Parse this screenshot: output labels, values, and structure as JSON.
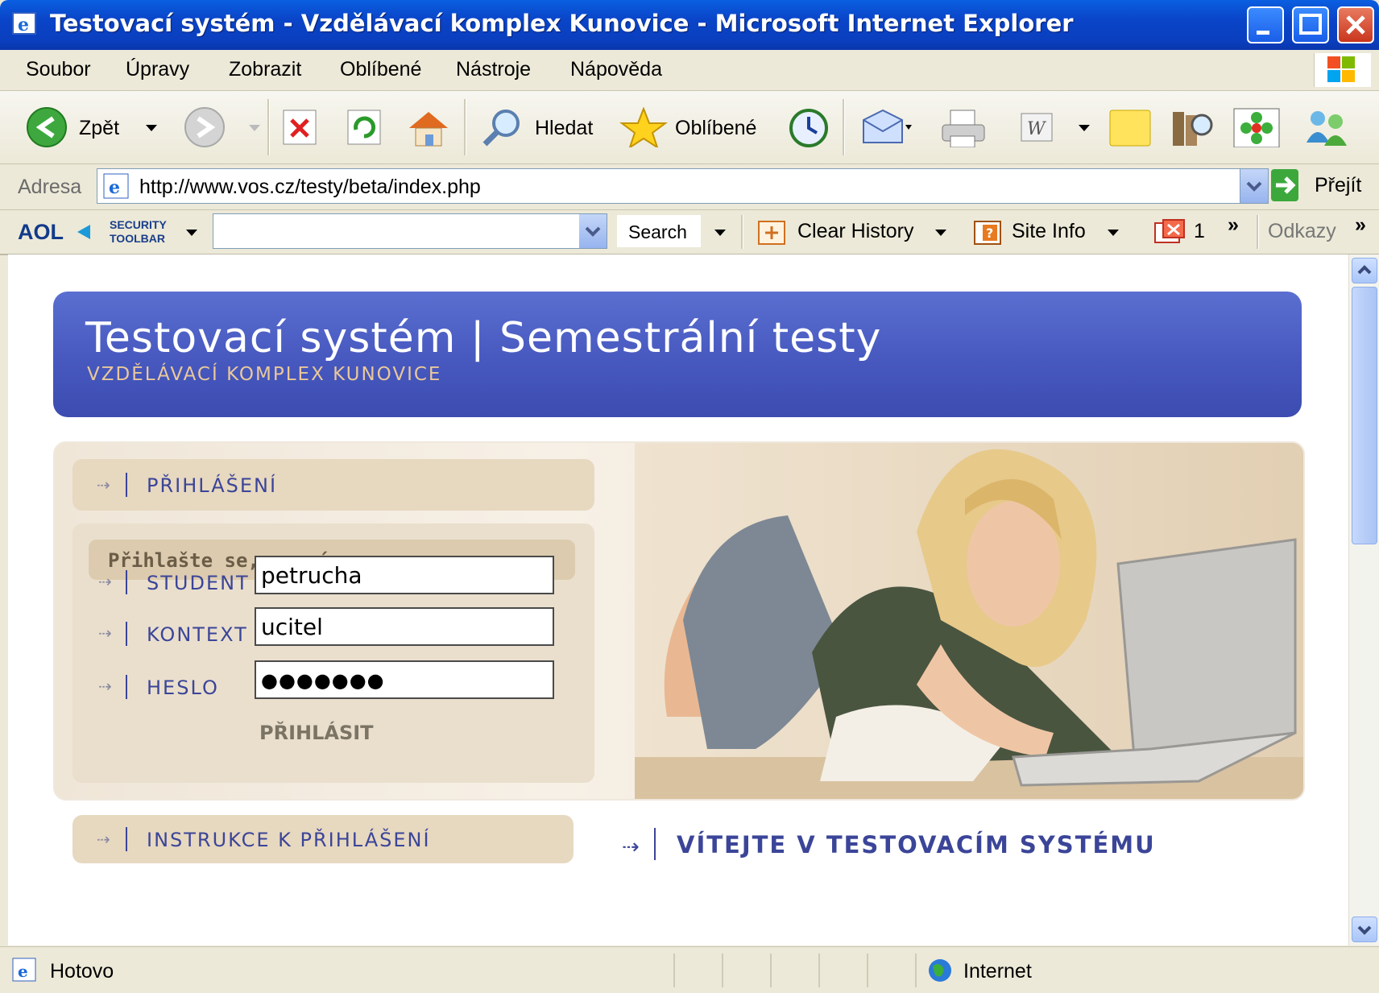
{
  "window": {
    "title": "Testovací systém - Vzdělávací komplex Kunovice - Microsoft Internet Explorer",
    "accent": "#0a44c8"
  },
  "menu": {
    "items": [
      "Soubor",
      "Úpravy",
      "Zobrazit",
      "Oblíbené",
      "Nástroje",
      "Nápověda"
    ]
  },
  "toolbar": {
    "back_label": "Zpět",
    "search_label": "Hledat",
    "favorites_label": "Oblíbené"
  },
  "address": {
    "label": "Adresa",
    "url": "http://www.vos.cz/testy/beta/index.php",
    "go_label": "Přejít"
  },
  "aol": {
    "brand": "AOL",
    "security_top": "SECURITY",
    "security_bottom": "TOOLBAR",
    "search_label": "Search",
    "clear_history": "Clear History",
    "site_info": "Site Info",
    "popup_count": "1",
    "links_label": "Odkazy"
  },
  "page": {
    "banner_title": "Testovací systém | Semestrální testy",
    "banner_subtitle": "VZDĚLÁVACÍ KOMPLEX KUNOVICE",
    "login_section": "PŘIHLÁŠENÍ",
    "login_prompt": "Přihlašte se, prosím.",
    "fields": {
      "student_label": "STUDENT",
      "student_value": "petrucha",
      "context_label": "KONTEXT",
      "context_value": "ucitel",
      "password_label": "HESLO",
      "password_value": "●●●●●●●"
    },
    "submit_label": "PŘIHLÁSIT",
    "instructions": "INSTRUKCE K PŘIHLÁŠENÍ",
    "welcome": "VÍTEJTE V TESTOVACÍM SYSTÉMU"
  },
  "status": {
    "text": "Hotovo",
    "zone": "Internet"
  }
}
